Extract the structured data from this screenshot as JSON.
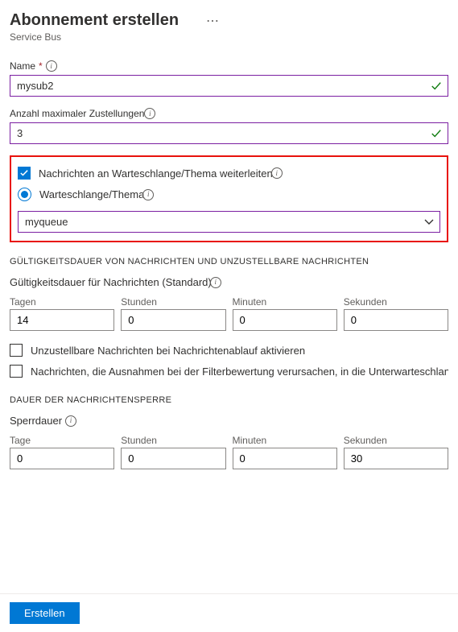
{
  "header": {
    "title": "Abonnement erstellen",
    "subtitle": "Service Bus"
  },
  "name": {
    "label": "Name",
    "value": "mysub2"
  },
  "maxDeliveries": {
    "label": "Anzahl maximaler Zustellungen",
    "value": "3",
    "info_label": "Anzahl maximaler Zustellungen"
  },
  "forward": {
    "checkbox_label": "Nachrichten an Warteschlange/Thema weiterleiten",
    "checkbox_info": "weiterleiten",
    "radio_label": "Warteschlange/Thema",
    "dropdown_value": "myqueue"
  },
  "ttlSection": {
    "header": "GÜLTIGKEITSDAUER VON NACHRICHTEN UND UNZUSTELLBARE NACHRICHTEN",
    "sub_label": "Gültigkeitsdauer für Nachrichten (Standard)",
    "days_label": "Tagen",
    "days_value": "14",
    "hours_label": "Stunden",
    "hours_value": "0",
    "minutes_label": "Minuten",
    "minutes_value": "0",
    "seconds_label": "Sekunden",
    "seconds_value": "0",
    "deadletter_label": "Unzustellbare Nachrichten bei Nachrichtenablauf aktivieren",
    "filterfail_label": "Nachrichten, die Ausnahmen bei der Filterbewertung verursachen, in die Unterwarteschlange für unzustellbare Nachrichten verschieben"
  },
  "lockSection": {
    "header": "DAUER DER NACHRICHTENSPERRE",
    "sub_label": "Sperrdauer",
    "days_label": "Tage",
    "days_value": "0",
    "hours_label": "Stunden",
    "hours_value": "0",
    "minutes_label": "Minuten",
    "minutes_value": "0",
    "seconds_label": "Sekunden",
    "seconds_value": "30"
  },
  "footer": {
    "create_label": "Erstellen"
  }
}
